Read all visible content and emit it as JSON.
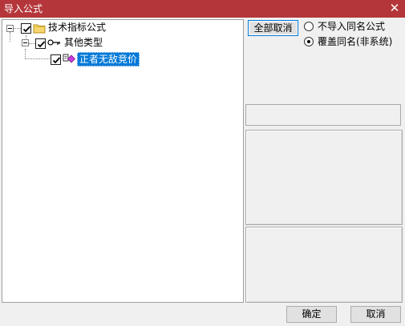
{
  "window": {
    "title": "导入公式",
    "close_glyph": "✕"
  },
  "tree": {
    "root": {
      "label": "技术指标公式",
      "checked": true,
      "expanded": true,
      "icon": "folder-icon"
    },
    "child": {
      "label": "其他类型",
      "checked": true,
      "expanded": true,
      "icon": "key-icon"
    },
    "leaf": {
      "label": "正者无敌竞价",
      "checked": true,
      "selected": true,
      "icon": "formula-icon"
    }
  },
  "options": {
    "select_toggle_label": "全部取消",
    "radio_skip_label": "不导入同名公式",
    "radio_overwrite_label": "覆盖同名(非系统)",
    "selected_radio": "overwrite"
  },
  "footer": {
    "ok_label": "确定",
    "cancel_label": "取消"
  },
  "colors": {
    "titlebar": "#b5363a",
    "selection": "#0078d7",
    "background": "#f0f0f0"
  }
}
